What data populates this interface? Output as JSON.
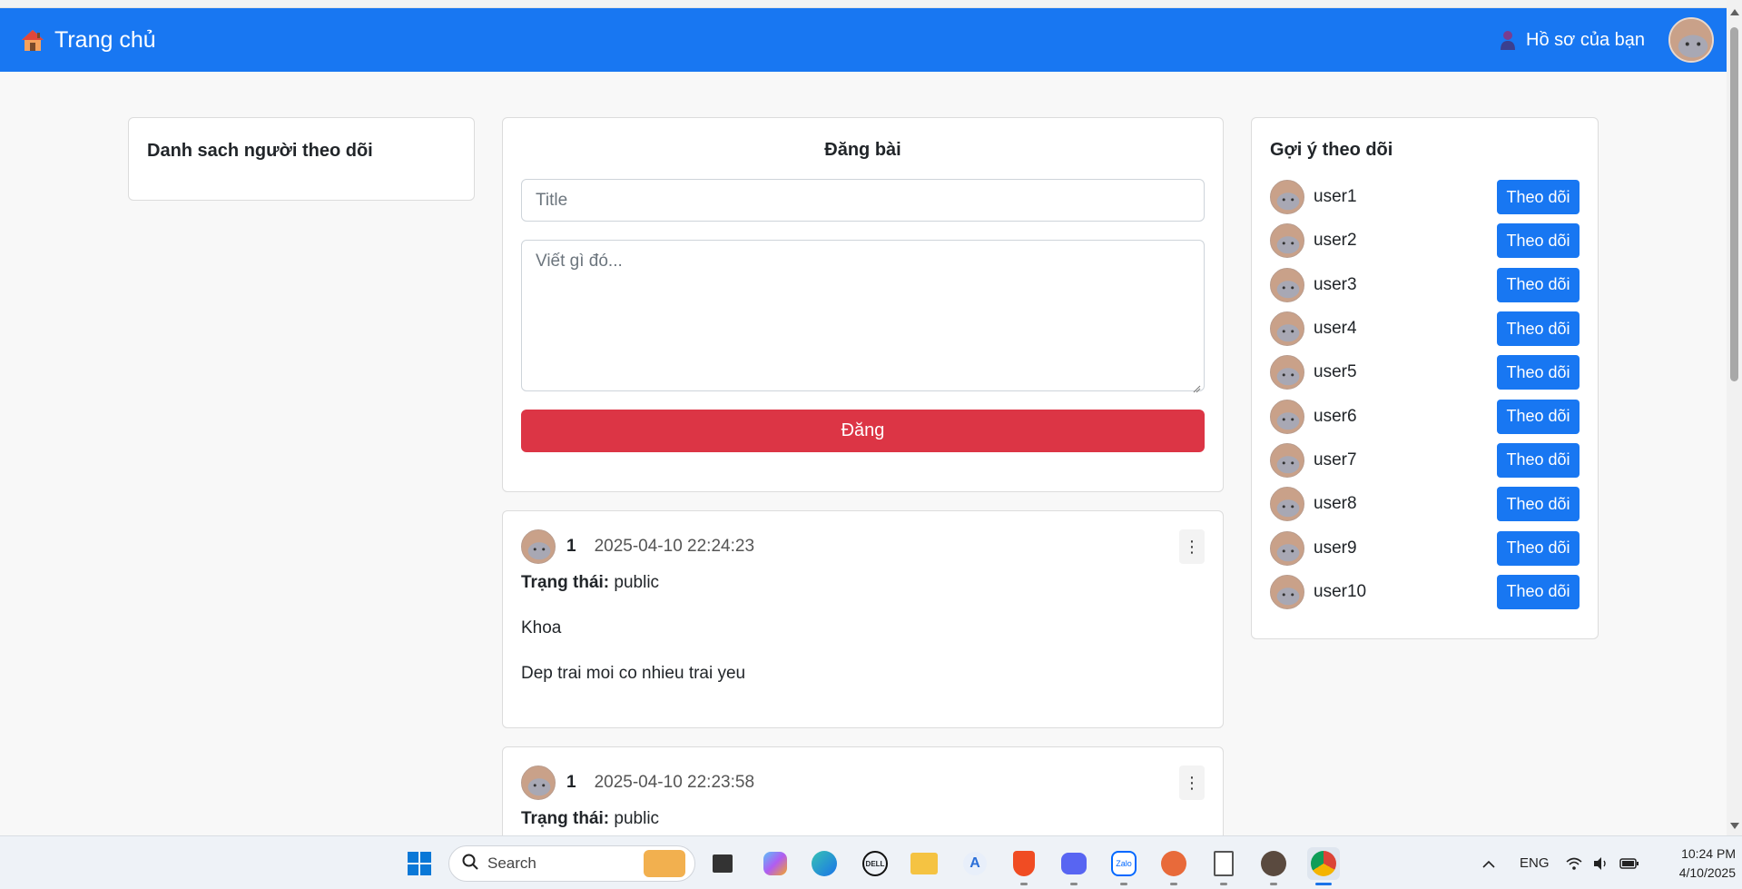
{
  "navbar": {
    "brand": "Trang chủ",
    "profile_label": "Hồ sơ của bạn"
  },
  "followers_card": {
    "title": "Danh sach người theo dõi"
  },
  "post_form": {
    "title": "Đăng bài",
    "title_placeholder": "Title",
    "content_placeholder": "Viết gì đó...",
    "submit_label": "Đăng"
  },
  "posts": [
    {
      "author": "1",
      "time": "2025-04-10 22:24:23",
      "status_label": "Trạng thái:",
      "status": "public",
      "title": "Khoa",
      "content": "Dep trai moi co nhieu trai yeu"
    },
    {
      "author": "1",
      "time": "2025-04-10 22:23:58",
      "status_label": "Trạng thái:",
      "status": "public"
    }
  ],
  "suggestions": {
    "title": "Gợi ý theo dõi",
    "follow_label": "Theo dõi",
    "users": [
      "user1",
      "user2",
      "user3",
      "user4",
      "user5",
      "user6",
      "user7",
      "user8",
      "user9",
      "user10"
    ]
  },
  "taskbar": {
    "search_placeholder": "Search",
    "language": "ENG",
    "time": "10:24 PM",
    "date": "4/10/2025"
  },
  "colors": {
    "primary": "#1877f2",
    "danger": "#dc3545",
    "background": "#f8f8f8"
  }
}
